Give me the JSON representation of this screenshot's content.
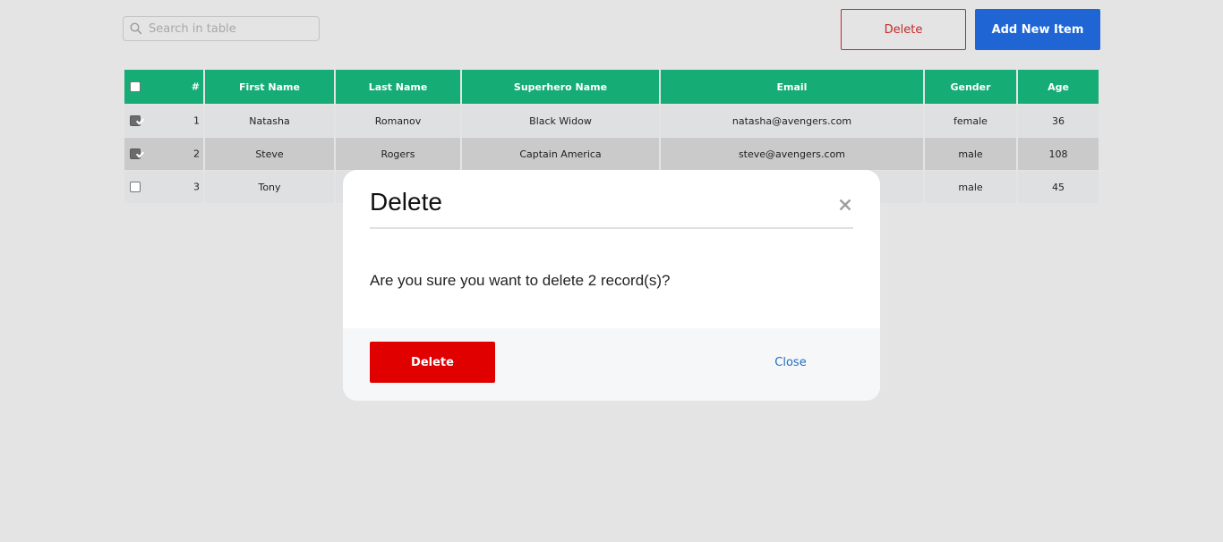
{
  "search": {
    "placeholder": "Search in table",
    "icon": "search-icon"
  },
  "toolbar": {
    "delete_label": "Delete",
    "add_label": "Add New Item"
  },
  "colors": {
    "header_green": "#15ac75",
    "add_blue": "#1f66d4",
    "delete_red": "#e00000",
    "close_blue": "#1e6fc0"
  },
  "table": {
    "columns": [
      "#",
      "First Name",
      "Last Name",
      "Superhero Name",
      "Email",
      "Gender",
      "Age"
    ],
    "rows": [
      {
        "checked": true,
        "id": "1",
        "first": "Natasha",
        "last": "Romanov",
        "hero": "Black Widow",
        "email": "natasha@avengers.com",
        "gender": "female",
        "age": "36"
      },
      {
        "checked": true,
        "id": "2",
        "first": "Steve",
        "last": "Rogers",
        "hero": "Captain America",
        "email": "steve@avengers.com",
        "gender": "male",
        "age": "108"
      },
      {
        "checked": false,
        "id": "3",
        "first": "Tony",
        "last": "",
        "hero": "",
        "email": "",
        "gender": "male",
        "age": "45"
      }
    ]
  },
  "modal": {
    "title": "Delete",
    "message": "Are you sure you want to delete 2 record(s)?",
    "confirm_label": "Delete",
    "close_label": "Close",
    "close_icon": "close-icon"
  }
}
